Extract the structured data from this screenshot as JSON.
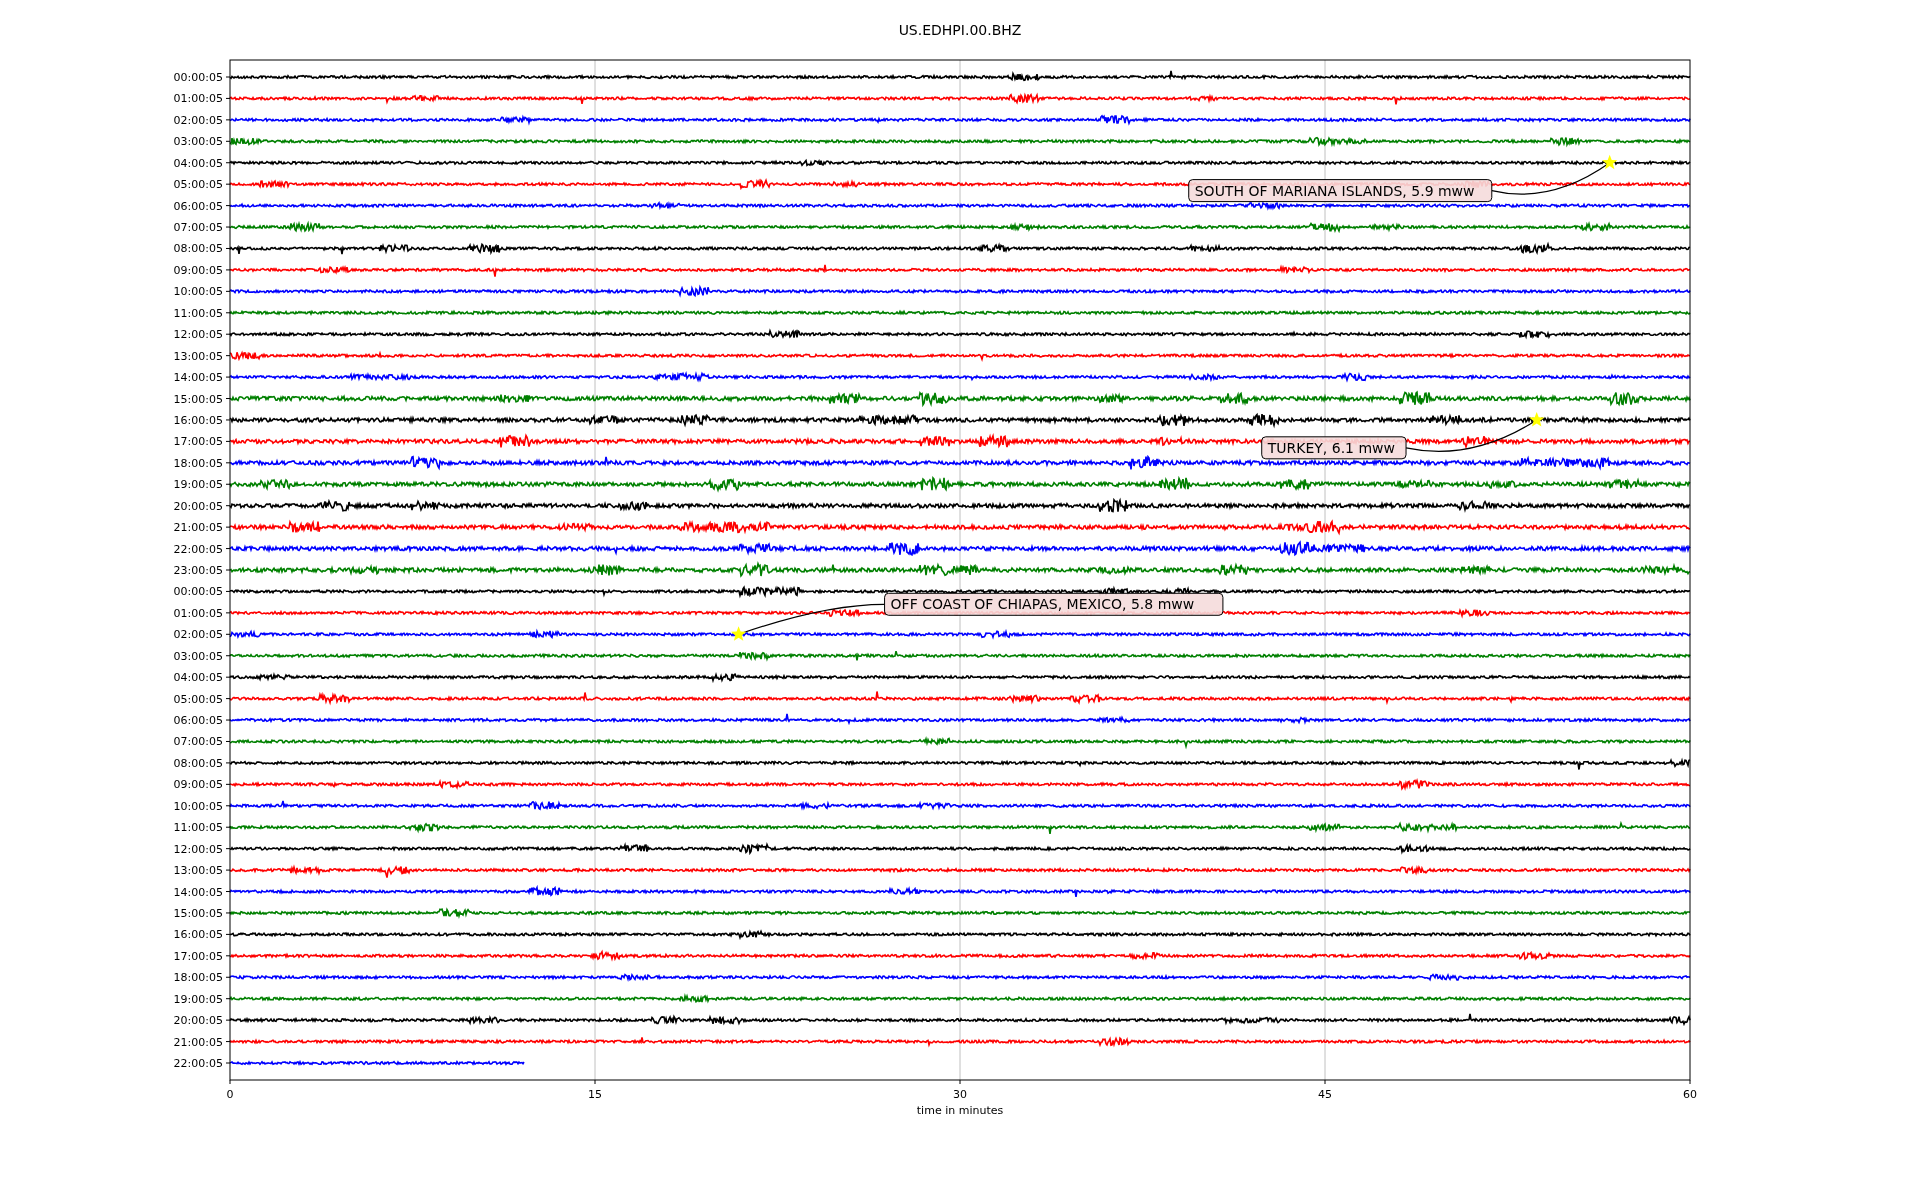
{
  "plot": {
    "title": "US.EDHPI.00.BHZ",
    "xlabel": "time in minutes",
    "x_ticks": [
      "0",
      "15",
      "30",
      "45",
      "60"
    ],
    "rows": [
      {
        "label": "00:00:05",
        "color": "#000000"
      },
      {
        "label": "01:00:05",
        "color": "#ff0000"
      },
      {
        "label": "02:00:05",
        "color": "#0000ff"
      },
      {
        "label": "03:00:05",
        "color": "#008000"
      },
      {
        "label": "04:00:05",
        "color": "#000000"
      },
      {
        "label": "05:00:05",
        "color": "#ff0000"
      },
      {
        "label": "06:00:05",
        "color": "#0000ff"
      },
      {
        "label": "07:00:05",
        "color": "#008000"
      },
      {
        "label": "08:00:05",
        "color": "#000000"
      },
      {
        "label": "09:00:05",
        "color": "#ff0000"
      },
      {
        "label": "10:00:05",
        "color": "#0000ff"
      },
      {
        "label": "11:00:05",
        "color": "#008000"
      },
      {
        "label": "12:00:05",
        "color": "#000000"
      },
      {
        "label": "13:00:05",
        "color": "#ff0000"
      },
      {
        "label": "14:00:05",
        "color": "#0000ff"
      },
      {
        "label": "15:00:05",
        "color": "#008000"
      },
      {
        "label": "16:00:05",
        "color": "#000000"
      },
      {
        "label": "17:00:05",
        "color": "#ff0000"
      },
      {
        "label": "18:00:05",
        "color": "#0000ff"
      },
      {
        "label": "19:00:05",
        "color": "#008000"
      },
      {
        "label": "20:00:05",
        "color": "#000000"
      },
      {
        "label": "21:00:05",
        "color": "#ff0000"
      },
      {
        "label": "22:00:05",
        "color": "#0000ff"
      },
      {
        "label": "23:00:05",
        "color": "#008000"
      },
      {
        "label": "00:00:05",
        "color": "#000000"
      },
      {
        "label": "01:00:05",
        "color": "#ff0000"
      },
      {
        "label": "02:00:05",
        "color": "#0000ff"
      },
      {
        "label": "03:00:05",
        "color": "#008000"
      },
      {
        "label": "04:00:05",
        "color": "#000000"
      },
      {
        "label": "05:00:05",
        "color": "#ff0000"
      },
      {
        "label": "06:00:05",
        "color": "#0000ff"
      },
      {
        "label": "07:00:05",
        "color": "#008000"
      },
      {
        "label": "08:00:05",
        "color": "#000000"
      },
      {
        "label": "09:00:05",
        "color": "#ff0000"
      },
      {
        "label": "10:00:05",
        "color": "#0000ff"
      },
      {
        "label": "11:00:05",
        "color": "#008000"
      },
      {
        "label": "12:00:05",
        "color": "#000000"
      },
      {
        "label": "13:00:05",
        "color": "#ff0000"
      },
      {
        "label": "14:00:05",
        "color": "#0000ff"
      },
      {
        "label": "15:00:05",
        "color": "#008000"
      },
      {
        "label": "16:00:05",
        "color": "#000000"
      },
      {
        "label": "17:00:05",
        "color": "#ff0000"
      },
      {
        "label": "18:00:05",
        "color": "#0000ff"
      },
      {
        "label": "19:00:05",
        "color": "#008000"
      },
      {
        "label": "20:00:05",
        "color": "#000000"
      },
      {
        "label": "21:00:05",
        "color": "#ff0000"
      },
      {
        "label": "22:00:05",
        "color": "#0000ff"
      }
    ],
    "annotations": [
      {
        "text": "SOUTH OF MARIANA ISLANDS, 5.9 mww"
      },
      {
        "text": "TURKEY, 6.1 mww"
      },
      {
        "text": "OFF COAST OF CHIAPAS, MEXICO, 5.8 mww"
      }
    ]
  }
}
